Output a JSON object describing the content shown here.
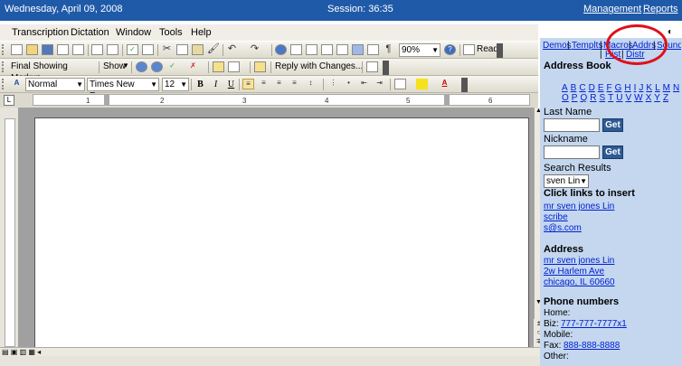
{
  "topbar": {
    "date": "Wednesday, April 09, 2008",
    "session": "Session: 36:35",
    "management": "Management",
    "reports": "Reports"
  },
  "menu": [
    "Transcription",
    "Dictation",
    "Window",
    "Tools",
    "Help"
  ],
  "toolbar1": {
    "zoom": "90%",
    "read": "Read"
  },
  "toolbar2": {
    "markup": "Final Showing Markup",
    "show": "Show",
    "reply": "Reply with Changes..."
  },
  "toolbar3": {
    "style": "Normal",
    "font": "Times New Roman",
    "size": "12",
    "bold": "B",
    "italic": "I",
    "underline": "U"
  },
  "ruler_ticks": [
    "1",
    "2",
    "3",
    "4",
    "5",
    "6"
  ],
  "panel": {
    "nav_links": [
      "Demos",
      "Templts",
      "Macros",
      "Addrs",
      "Sound"
    ],
    "nav_links2": [
      "Hist",
      "Distr"
    ],
    "section_title": "Address Book",
    "letters_row1": [
      "A",
      "B",
      "C",
      "D",
      "E",
      "F",
      "G",
      "H",
      "I",
      "J",
      "K",
      "L",
      "M",
      "N"
    ],
    "letters_row2": [
      "O",
      "P",
      "Q",
      "R",
      "S",
      "T",
      "U",
      "V",
      "W",
      "X",
      "Y",
      "Z"
    ],
    "last_name_label": "Last Name",
    "nickname_label": "Nickname",
    "get_label": "Get",
    "search_results_label": "Search Results",
    "search_selected": "sven Lin",
    "click_links": "Click links to insert",
    "name_links": [
      "mr sven jones Lin",
      "scribe",
      "s@s.com"
    ],
    "address_title": "Address",
    "address_links": [
      "mr sven jones Lin",
      "2w Harlem Ave",
      "chicago, IL 60660"
    ],
    "phone_title": "Phone numbers",
    "home_label": "Home:",
    "biz_label": "Biz:",
    "biz_value": "777-777-7777x1",
    "mobile_label": "Mobile:",
    "fax_label": "Fax:",
    "fax_value": "888-888-8888",
    "other_label": "Other:"
  },
  "colors": {
    "topbar": "#1f5aa8",
    "panel": "#c4d7ef",
    "highlight": "#e0101a",
    "link": "#0020d0"
  }
}
